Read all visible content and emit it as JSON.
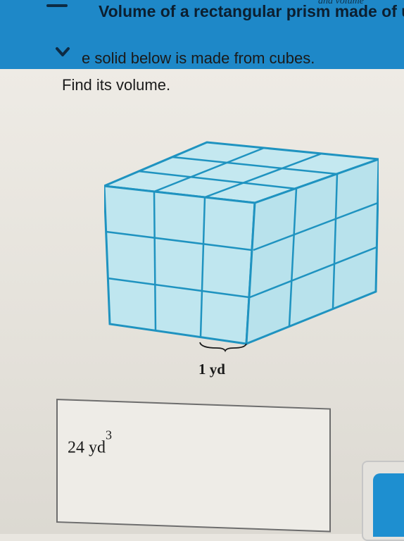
{
  "header": {
    "top_text_cut": "and volume",
    "title": "Volume of a rectangular prism made of u"
  },
  "question": {
    "line1": "e solid below is made from cubes.",
    "line2": "Find its volume."
  },
  "figure": {
    "unit_label": "1 yd",
    "rows": 3,
    "front_columns": 3,
    "depth": 3,
    "face_color": "#bfe6ef",
    "edge_color": "#1f93c0"
  },
  "answer": {
    "value": "24 yd",
    "exponent": "3"
  },
  "colors": {
    "accent": "#1e88c8"
  }
}
